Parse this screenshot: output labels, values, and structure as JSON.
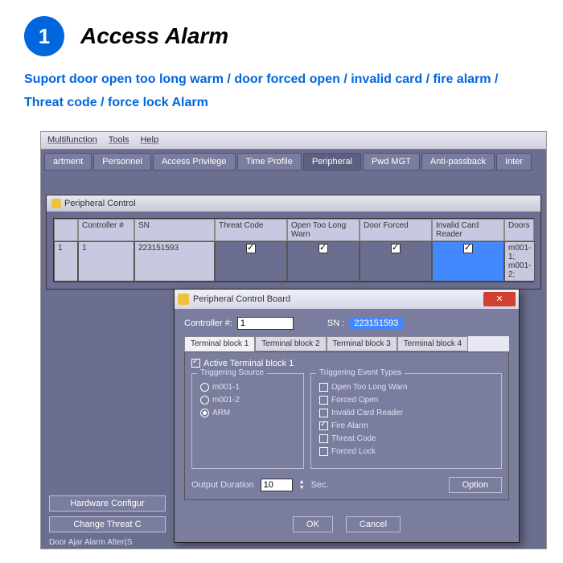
{
  "header": {
    "num": "1",
    "title": "Access Alarm"
  },
  "subtitle": "Suport door open too long warm / door forced open / invalid card / fire alarm / Threat code / force lock Alarm",
  "menubar": [
    "Multifunction",
    "Tools",
    "Help"
  ],
  "tabs": [
    "artment",
    "Personnel",
    "Access Privilege",
    "Time Profile",
    "Peripheral",
    "Pwd MGT",
    "Anti-passback",
    "Inter"
  ],
  "activeTab": 4,
  "subwin_title": "Peripheral Control",
  "grid": {
    "headers": [
      "",
      "Controller #",
      "SN",
      "Threat Code",
      "Open Too Long Warn",
      "Door Forced",
      "Invalid Card Reader",
      "Doors"
    ],
    "row": {
      "idx": "1",
      "ctrl": "1",
      "sn": "223151593",
      "threat": true,
      "open": true,
      "forced": true,
      "invalid": true,
      "doors": "m001-1; m001-2;"
    }
  },
  "dialog": {
    "title": "Peripheral Control Board",
    "ctrl_label": "Controller #:",
    "ctrl_val": "1",
    "sn_label": "SN :",
    "sn_val": "223151593",
    "tabs": [
      "Terminal block 1",
      "Terminal block 2",
      "Terminal block 3",
      "Terminal block 4"
    ],
    "activeTab": 0,
    "active_chk": "Active Terminal block 1",
    "active_chk_on": true,
    "src_title": "Triggering Source",
    "src_opts": [
      {
        "label": "m001-1",
        "on": false
      },
      {
        "label": "m001-2",
        "on": false
      },
      {
        "label": "ARM",
        "on": true
      }
    ],
    "evt_title": "Triggering Event Types",
    "evt_opts": [
      {
        "label": "Open Too Long Warn",
        "on": false
      },
      {
        "label": "Forced Open",
        "on": false
      },
      {
        "label": "Invalid Card Reader",
        "on": false
      },
      {
        "label": "Fire Alarm",
        "on": true
      },
      {
        "label": "Threat Code",
        "on": false
      },
      {
        "label": "Forced Lock",
        "on": false
      }
    ],
    "out_label": "Output Duration",
    "out_val": "10",
    "out_unit": "Sec.",
    "option_btn": "Option",
    "ok": "OK",
    "cancel": "Cancel"
  },
  "bottom": {
    "btn1": "Hardware Configur",
    "btn2": "Change Threat C",
    "line": "Door Ajar Alarm After(S"
  }
}
